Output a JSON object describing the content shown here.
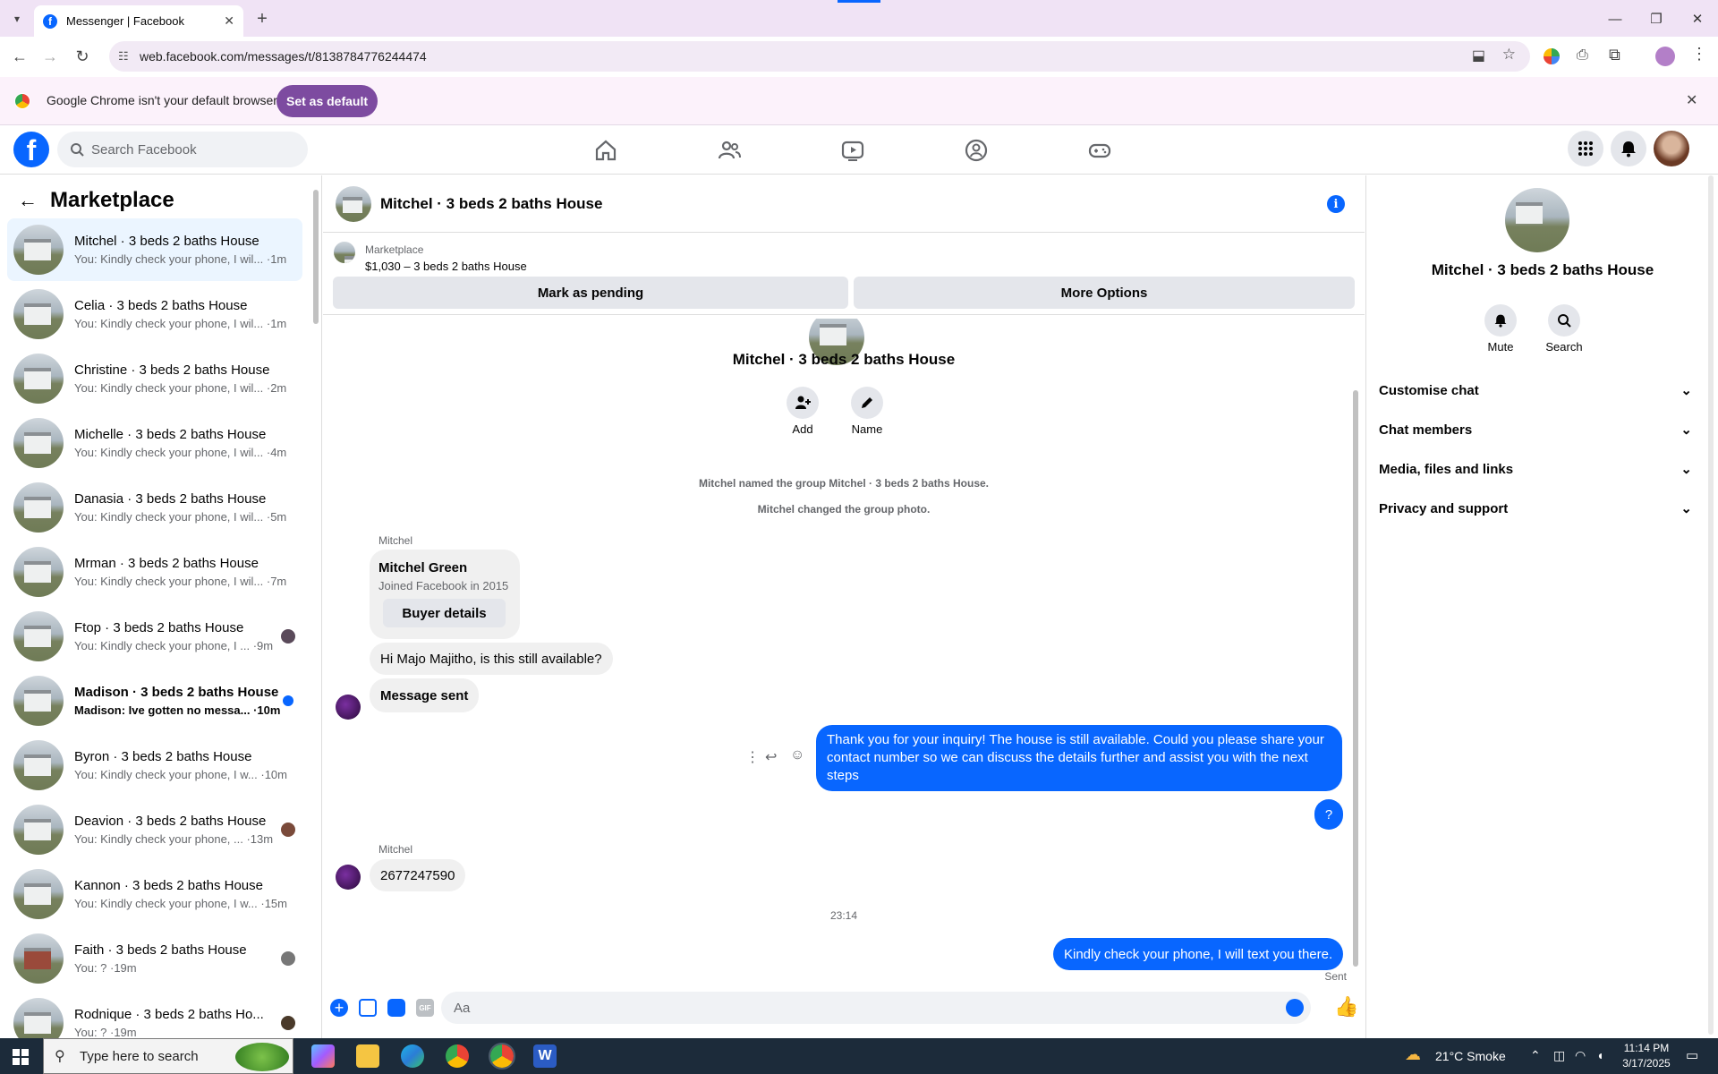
{
  "browser": {
    "tab_title": "Messenger | Facebook",
    "url": "web.facebook.com/messages/t/8138784776244474",
    "infobar_text": "Google Chrome isn't your default browser",
    "set_default_label": "Set as default"
  },
  "fbnav": {
    "search_placeholder": "Search Facebook"
  },
  "sidebar": {
    "title": "Marketplace",
    "conversations": [
      {
        "name": "Mitchel · 3 beds 2 baths House",
        "preview": "You: Kindly check your phone, I wil... ·1m"
      },
      {
        "name": "Celia · 3 beds 2 baths House",
        "preview": "You: Kindly check your phone, I wil... ·1m"
      },
      {
        "name": "Christine · 3 beds 2 baths House",
        "preview": "You: Kindly check your phone, I wil... ·2m"
      },
      {
        "name": "Michelle · 3 beds 2 baths House",
        "preview": "You: Kindly check your phone, I wil... ·4m"
      },
      {
        "name": "Danasia · 3 beds 2 baths House",
        "preview": "You: Kindly check your phone, I wil... ·5m"
      },
      {
        "name": "Mrman · 3 beds 2 baths House",
        "preview": "You: Kindly check your phone, I wil... ·7m"
      },
      {
        "name": "Ftop · 3 beds 2 baths House",
        "preview": "You: Kindly check your phone, I ... ·9m"
      },
      {
        "name": "Madison · 3 beds 2 baths House",
        "preview": "Madison: Ive gotten no messa... ·10m"
      },
      {
        "name": "Byron · 3 beds 2 baths House",
        "preview": "You: Kindly check your phone, I w... ·10m"
      },
      {
        "name": "Deavion · 3 beds 2 baths House",
        "preview": "You: Kindly check your phone, ... ·13m"
      },
      {
        "name": "Kannon · 3 beds 2 baths House",
        "preview": "You: Kindly check your phone, I w... ·15m"
      },
      {
        "name": "Faith · 3 beds 2 baths House",
        "preview": "You: ? ·19m"
      },
      {
        "name": "Rodnique · 3 beds 2 baths Ho...",
        "preview": "You: ? ·19m"
      }
    ]
  },
  "chat": {
    "title": "Mitchel · 3 beds 2 baths House",
    "marketplace_label": "Marketplace",
    "listing": "$1,030 – 3 beds 2 baths House",
    "mark_pending": "Mark as pending",
    "more_options": "More Options",
    "group_name": "Mitchel · 3 beds 2 baths House",
    "add_label": "Add",
    "name_label": "Name",
    "sys1": "Mitchel named the group Mitchel · 3 beds 2 baths House.",
    "sys2": "Mitchel changed the group photo.",
    "sender1": "Mitchel",
    "card_name": "Mitchel Green",
    "card_sub": "Joined Facebook in 2015",
    "buyer_details": "Buyer details",
    "msg1": "Hi Majo Majitho, is this still available?",
    "msg2": "Message sent",
    "msg3": "Thank you for your inquiry! The house is still available. Could you please share your contact number so we can discuss the details further and assist you with the next steps",
    "msg4": "?",
    "sender2": "Mitchel",
    "msg5": "2677247590",
    "time": "23:14",
    "msg6": "Kindly check your phone, I will text you there.",
    "sent": "Sent",
    "input_placeholder": "Aa"
  },
  "right": {
    "name": "Mitchel · 3 beds 2 baths House",
    "mute": "Mute",
    "search": "Search",
    "sections": [
      "Customise chat",
      "Chat members",
      "Media, files and links",
      "Privacy and support"
    ]
  },
  "taskbar": {
    "search_placeholder": "Type here to search",
    "weather": "21°C  Smoke",
    "time": "11:14 PM",
    "date": "3/17/2025"
  },
  "colors": {
    "accent": "#0866ff",
    "chrome_purple": "#7d4ba0"
  }
}
